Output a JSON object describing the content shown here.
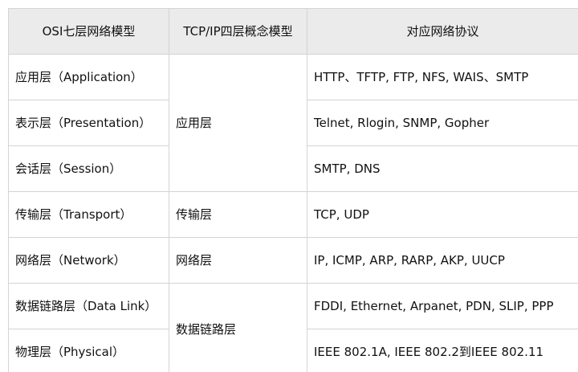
{
  "table": {
    "headers": [
      "OSI七层网络模型",
      "TCP/IP四层概念模型",
      "对应网络协议"
    ],
    "rows": [
      {
        "osi": "应用层（Application）",
        "protocols": "HTTP、TFTP, FTP, NFS, WAIS、SMTP"
      },
      {
        "osi": "表示层（Presentation）",
        "protocols": "Telnet, Rlogin, SNMP, Gopher"
      },
      {
        "osi": "会话层（Session）",
        "protocols": "SMTP, DNS"
      },
      {
        "osi": "传输层（Transport）",
        "protocols": "TCP, UDP"
      },
      {
        "osi": "网络层（Network）",
        "protocols": "IP, ICMP, ARP, RARP, AKP, UUCP"
      },
      {
        "osi": "数据链路层（Data Link）",
        "protocols": "FDDI, Ethernet, Arpanet, PDN, SLIP, PPP"
      },
      {
        "osi": "物理层（Physical）",
        "protocols": "IEEE 802.1A, IEEE 802.2到IEEE 802.11"
      }
    ],
    "tcpip_groups": [
      "应用层",
      "传输层",
      "网络层",
      "数据链路层"
    ]
  }
}
